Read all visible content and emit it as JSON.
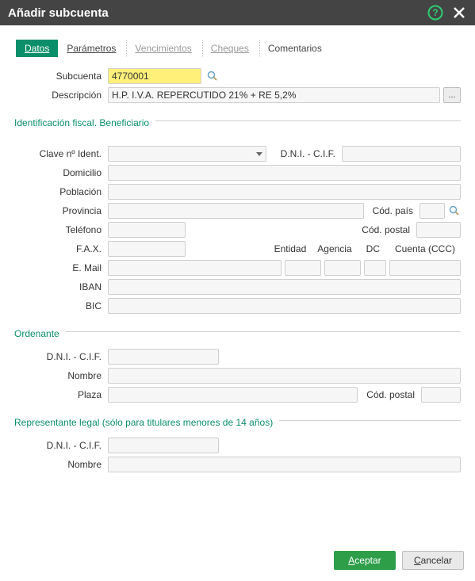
{
  "window": {
    "title": "Añadir subcuenta"
  },
  "tabs": {
    "datos": "Datos",
    "parametros": "Parámetros",
    "vencimientos": "Vencimientos",
    "cheques": "Cheques",
    "comentarios": "Comentarios"
  },
  "top": {
    "subcuenta_label": "Subcuenta",
    "subcuenta_value": "4770001",
    "descripcion_label": "Descripción",
    "descripcion_value": "H.P. I.V.A. REPERCUTIDO 21% + RE 5,2%",
    "more_button": "..."
  },
  "sec1": {
    "legend": "Identificación fiscal. Beneficiario",
    "clave_label": "Clave nº Ident.",
    "clave_value": "",
    "dni_label": "D.N.I. - C.I.F.",
    "dni_value": "",
    "domicilio_label": "Domicilio",
    "domicilio_value": "",
    "poblacion_label": "Población",
    "poblacion_value": "",
    "provincia_label": "Provincia",
    "provincia_value": "",
    "codpais_label": "Cód. país",
    "codpais_value": "",
    "telefono_label": "Teléfono",
    "telefono_value": "",
    "codpostal_label": "Cód. postal",
    "codpostal_value": "",
    "fax_label": "F.A.X.",
    "fax_value": "",
    "entidad_label": "Entidad",
    "agencia_label": "Agencia",
    "dc_label": "DC",
    "cuenta_label": "Cuenta (CCC)",
    "entidad_value": "",
    "agencia_value": "",
    "dc_value": "",
    "cuenta_value": "",
    "email_label": "E. Mail",
    "email_value": "",
    "iban_label": "IBAN",
    "iban_value": "",
    "bic_label": "BIC",
    "bic_value": ""
  },
  "sec2": {
    "legend": "Ordenante",
    "dni_label": "D.N.I. - C.I.F.",
    "dni_value": "",
    "nombre_label": "Nombre",
    "nombre_value": "",
    "plaza_label": "Plaza",
    "plaza_value": "",
    "codpostal_label": "Cód. postal",
    "codpostal_value": ""
  },
  "sec3": {
    "legend": "Representante legal (sólo para titulares menores de 14 años)",
    "dni_label": "D.N.I. - C.I.F.",
    "dni_value": "",
    "nombre_label": "Nombre",
    "nombre_value": ""
  },
  "footer": {
    "accept": "Aceptar",
    "cancel": "Cancelar"
  }
}
